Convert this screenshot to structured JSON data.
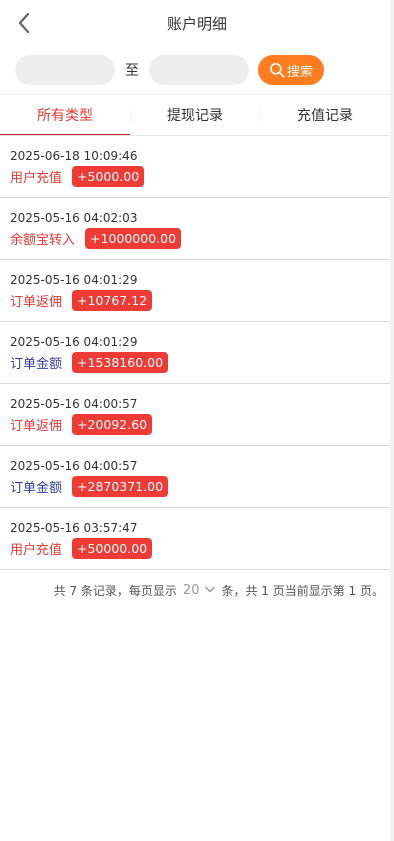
{
  "header": {
    "title": "账户明细",
    "back_icon": "chevron-left-icon"
  },
  "search": {
    "start_value": "",
    "end_value": "",
    "to_label": "至",
    "button_label": "搜索",
    "button_icon": "search-icon",
    "button_color": "#ff7c1f"
  },
  "tabs": [
    {
      "label": "所有类型",
      "active": true
    },
    {
      "label": "提现记录",
      "active": false
    },
    {
      "label": "充值记录",
      "active": false
    }
  ],
  "records": [
    {
      "time": "2025-06-18 10:09:46",
      "type": "用户充值",
      "amount": "+5000.00",
      "type_color": "red"
    },
    {
      "time": "2025-05-16 04:02:03",
      "type": "余额宝转入",
      "amount": "+1000000.00",
      "type_color": "red"
    },
    {
      "time": "2025-05-16 04:01:29",
      "type": "订单返佣",
      "amount": "+10767.12",
      "type_color": "red"
    },
    {
      "time": "2025-05-16 04:01:29",
      "type": "订单金额",
      "amount": "+1538160.00",
      "type_color": "blue"
    },
    {
      "time": "2025-05-16 04:00:57",
      "type": "订单返佣",
      "amount": "+20092.60",
      "type_color": "red"
    },
    {
      "time": "2025-05-16 04:00:57",
      "type": "订单金额",
      "amount": "+2870371.00",
      "type_color": "blue"
    },
    {
      "time": "2025-05-16 03:57:47",
      "type": "用户充值",
      "amount": "+50000.00",
      "type_color": "red"
    }
  ],
  "pager": {
    "prefix": "共 7 条记录，每页显示",
    "page_size": "20",
    "suffix": "条，共 1 页当前显示第 1 页。"
  },
  "colors": {
    "accent_red": "#e53935",
    "badge_red": "#ef3b36",
    "type_blue": "#2f3fa0"
  }
}
